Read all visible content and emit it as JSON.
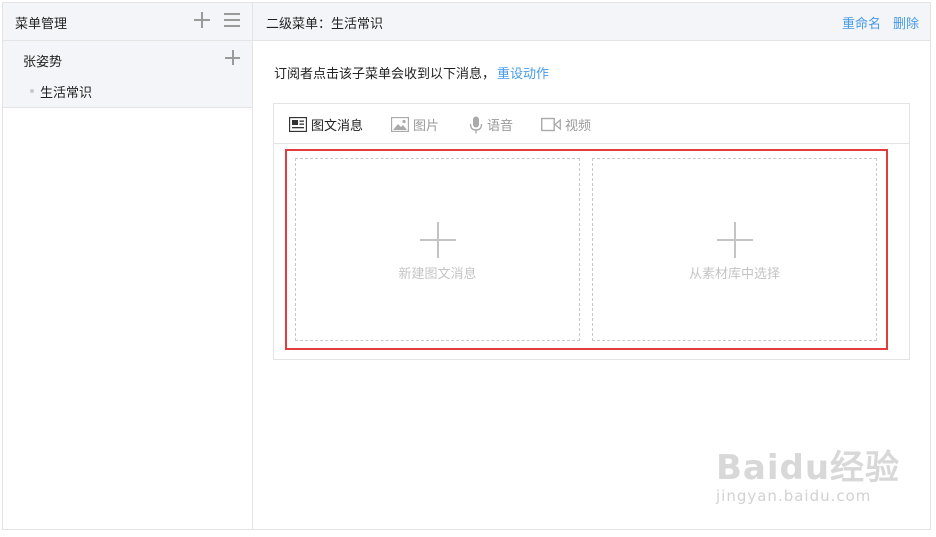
{
  "sidebar": {
    "title": "菜单管理",
    "items": [
      {
        "label": "张姿势",
        "children": [
          {
            "label": "生活常识"
          }
        ]
      }
    ]
  },
  "header": {
    "title": "二级菜单：生活常识",
    "rename_label": "重命名",
    "delete_label": "删除"
  },
  "main": {
    "description": "订阅者点击该子菜单会收到以下消息，",
    "reset_label": "重设动作",
    "tabs": [
      {
        "label": "图文消息",
        "icon": "news-icon",
        "active": true
      },
      {
        "label": "图片",
        "icon": "image-icon",
        "active": false
      },
      {
        "label": "语音",
        "icon": "microphone-icon",
        "active": false
      },
      {
        "label": "视频",
        "icon": "video-icon",
        "active": false
      }
    ],
    "slots": [
      {
        "label": "新建图文消息"
      },
      {
        "label": "从素材库中选择"
      }
    ]
  },
  "watermark": {
    "brand": "Baidu经验",
    "sub": "jingyan.baidu.com"
  },
  "colors": {
    "accent": "#459ae9",
    "highlight": "#e23c3c",
    "panel_bg": "#f4f5f9"
  }
}
